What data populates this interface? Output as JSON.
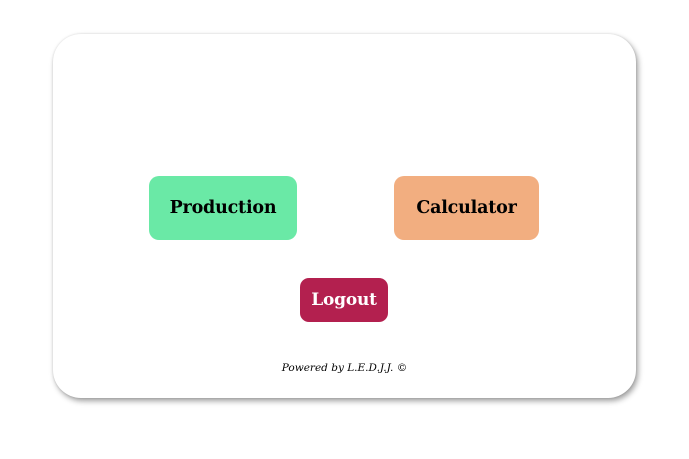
{
  "buttons": {
    "production_label": "Production",
    "calculator_label": "Calculator",
    "logout_label": "Logout"
  },
  "footer": {
    "text": "Powered by L.E.D.J.J. ©"
  },
  "colors": {
    "production": "#6ae9a6",
    "calculator": "#f2ae80",
    "logout": "#b3204f",
    "card_background": "#ffffff"
  }
}
